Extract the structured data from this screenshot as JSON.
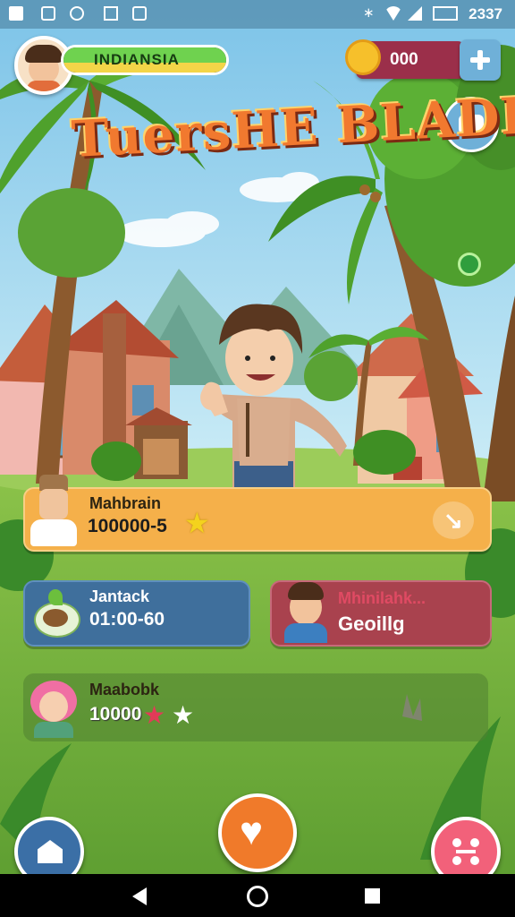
{
  "header": {
    "player_name": "INDIANSIA",
    "coins": "000",
    "title": "TuersHE BLADIAN"
  },
  "status": {
    "time": "2337"
  },
  "cards": {
    "main": {
      "title": "Mahbrain",
      "value": "100000-5"
    },
    "left": {
      "title": "Jantack",
      "value": "01:00-60"
    },
    "right": {
      "title": "Mhinilahk...",
      "value": "Geoillg"
    },
    "bottom": {
      "title": "Maabobk",
      "value": "10000"
    }
  },
  "colors": {
    "accent": "#f07a2a",
    "card_main": "#f5b04a",
    "card_left": "#3f6f9c",
    "card_right": "#a9424e"
  },
  "icons": [
    "home-icon",
    "heart-icon",
    "network-icon",
    "plus-icon",
    "cloud-icon"
  ]
}
